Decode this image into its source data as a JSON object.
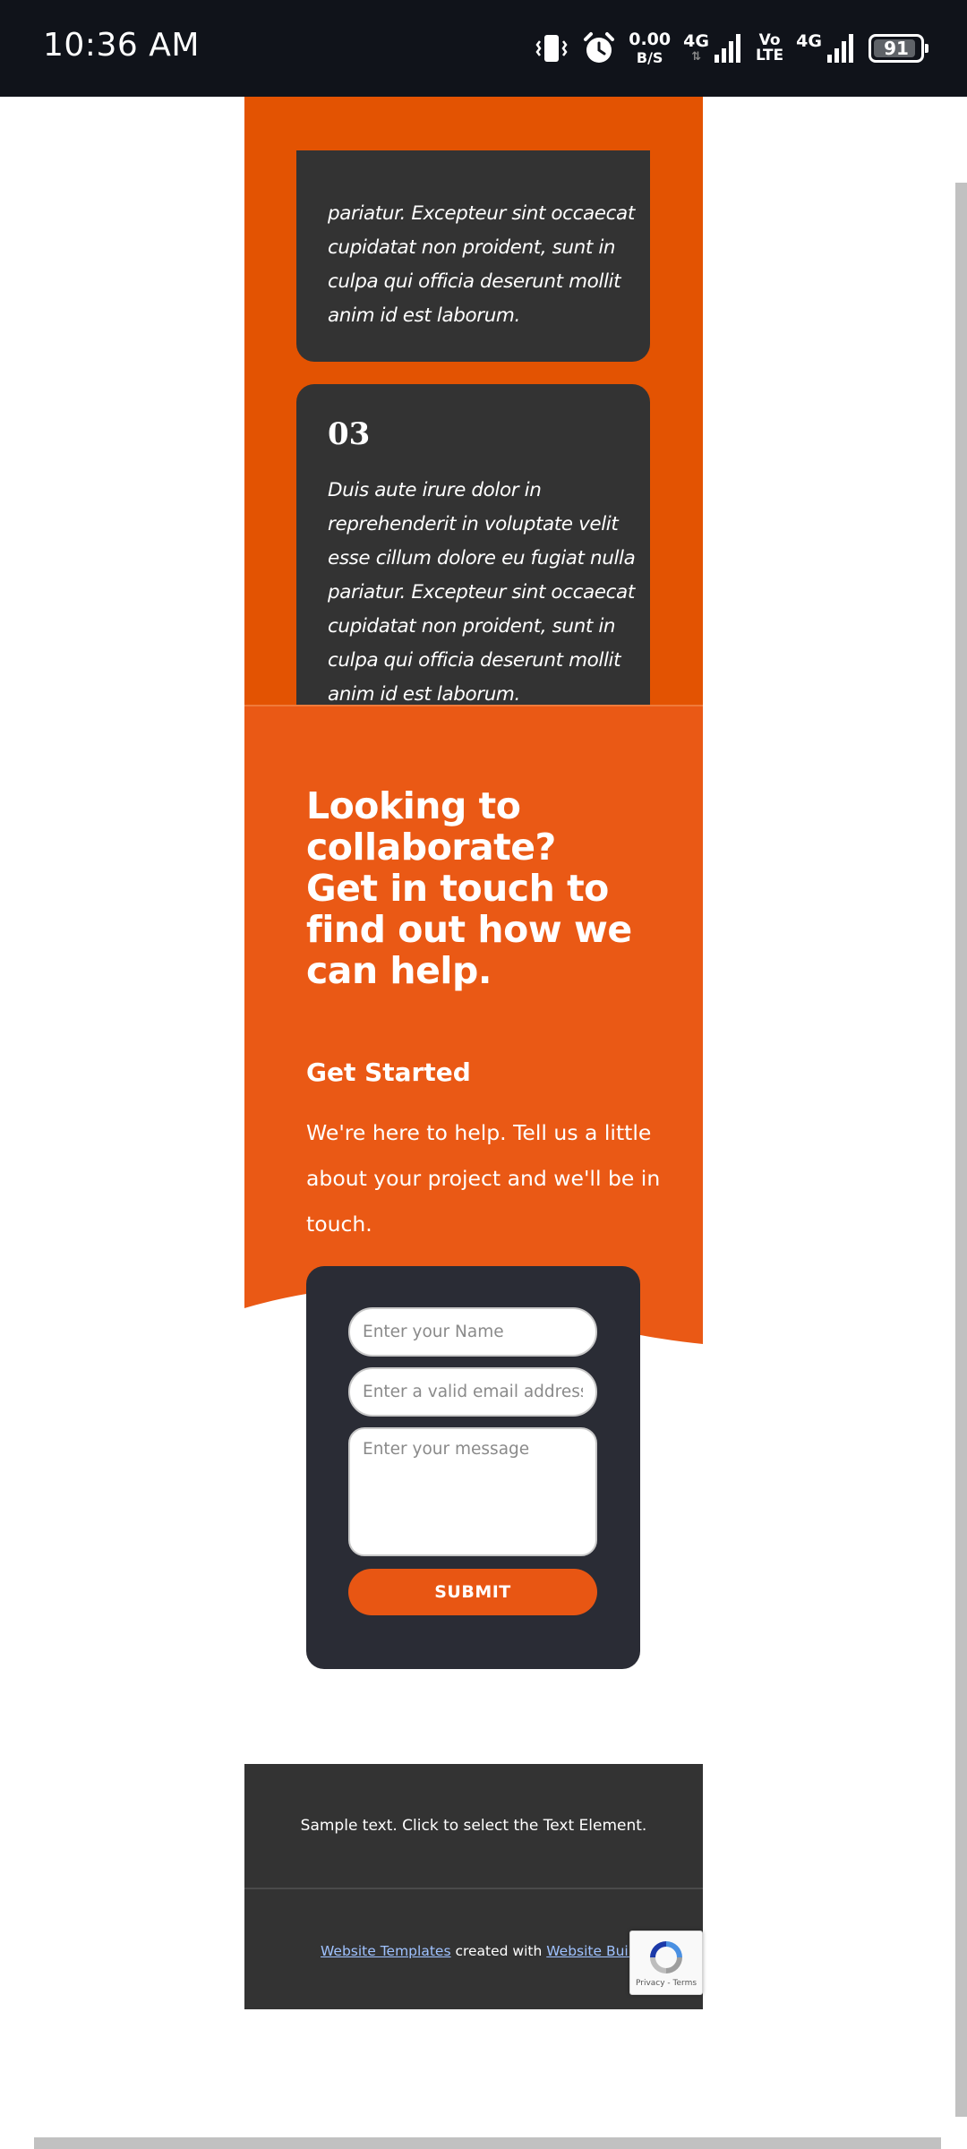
{
  "status_bar": {
    "time": "10:36 AM",
    "net_speed_value": "0.00",
    "net_speed_unit": "B/S",
    "signal_1_label": "4G",
    "volte_top": "Vo",
    "volte_bottom": "LTE",
    "signal_2_label": "4G",
    "battery_level": "91",
    "battery_fraction": 0.91,
    "icons": [
      "vibrate-icon",
      "alarm-icon",
      "signal-bars-icon",
      "signal-bars-icon",
      "battery-icon"
    ]
  },
  "feature_cards": [
    {
      "number": "",
      "lines": [
        "pariatur. Excepteur sint occaecat",
        "cupidatat non proident, sunt in",
        "culpa qui officia deserunt mollit",
        "anim id est laborum."
      ]
    },
    {
      "number": "03",
      "lines": [
        "Duis aute irure dolor in",
        "reprehenderit in voluptate velit",
        "esse cillum dolore eu fugiat nulla",
        "pariatur. Excepteur sint occaecat",
        "cupidatat non proident, sunt in",
        "culpa qui officia deserunt mollit",
        "anim id est laborum."
      ]
    }
  ],
  "cta": {
    "heading_lines": [
      "Looking to",
      "collaborate?",
      "Get in touch to",
      "find out how we",
      "can help."
    ],
    "subheading": "Get Started",
    "body_lines": [
      "We're here to help. Tell us a little",
      "about your project and we'll be in",
      "touch."
    ]
  },
  "form": {
    "name_placeholder": "Enter your Name",
    "email_placeholder": "Enter a valid email address",
    "message_placeholder": "Enter your message",
    "submit_label": "SUBMIT"
  },
  "footer": {
    "sample_text": "Sample text. Click to select the Text Element.",
    "link_1": "Website Templates",
    "middle_text": " created with ",
    "link_2": "Website Builder",
    "end_text": ".",
    "recaptcha_terms": "Privacy - Terms"
  },
  "colors": {
    "status_bar_bg": "#10131a",
    "orange_dark": "#e35302",
    "orange_cta": "#ea5915",
    "card_bg": "#333333",
    "form_bg": "#2a2c35",
    "submit_bg": "#e85613",
    "footer_bg": "#333333",
    "link": "#9fc2ff"
  }
}
